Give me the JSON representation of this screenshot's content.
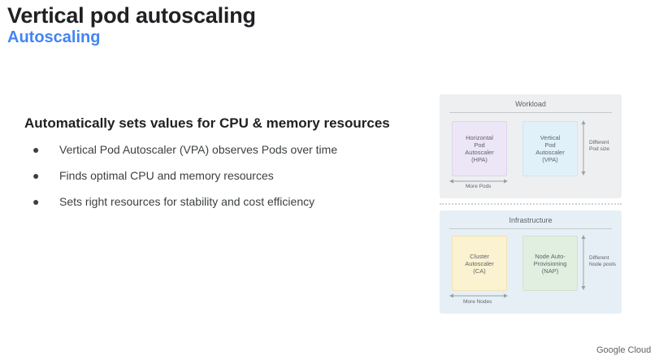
{
  "slide": {
    "title": "Vertical pod autoscaling",
    "subtitle": "Autoscaling",
    "heading": "Automatically sets values for CPU & memory resources",
    "bullets": [
      "Vertical Pod Autoscaler (VPA) observes Pods over time",
      "Finds optimal CPU and memory resources",
      "Sets right resources for stability and cost efficiency"
    ],
    "bullet_glyph": "●"
  },
  "diagram": {
    "workload": {
      "title": "Workload",
      "hpa": "Horizontal\nPod\nAutoscaler\n(HPA)",
      "vpa": "Vertical\nPod\nAutoscaler\n(VPA)",
      "horizontal_arrow_label": "More Pods",
      "vertical_arrow_label": "Different\nPod size"
    },
    "infrastructure": {
      "title": "Infrastructure",
      "ca": "Cluster\nAutoscaler\n(CA)",
      "nap": "Node Auto-\nProvisioning\n(NAP)",
      "horizontal_arrow_label": "More Nodes",
      "vertical_arrow_label": "Different\nNode pools"
    }
  },
  "footer": {
    "brand": "Google Cloud"
  }
}
